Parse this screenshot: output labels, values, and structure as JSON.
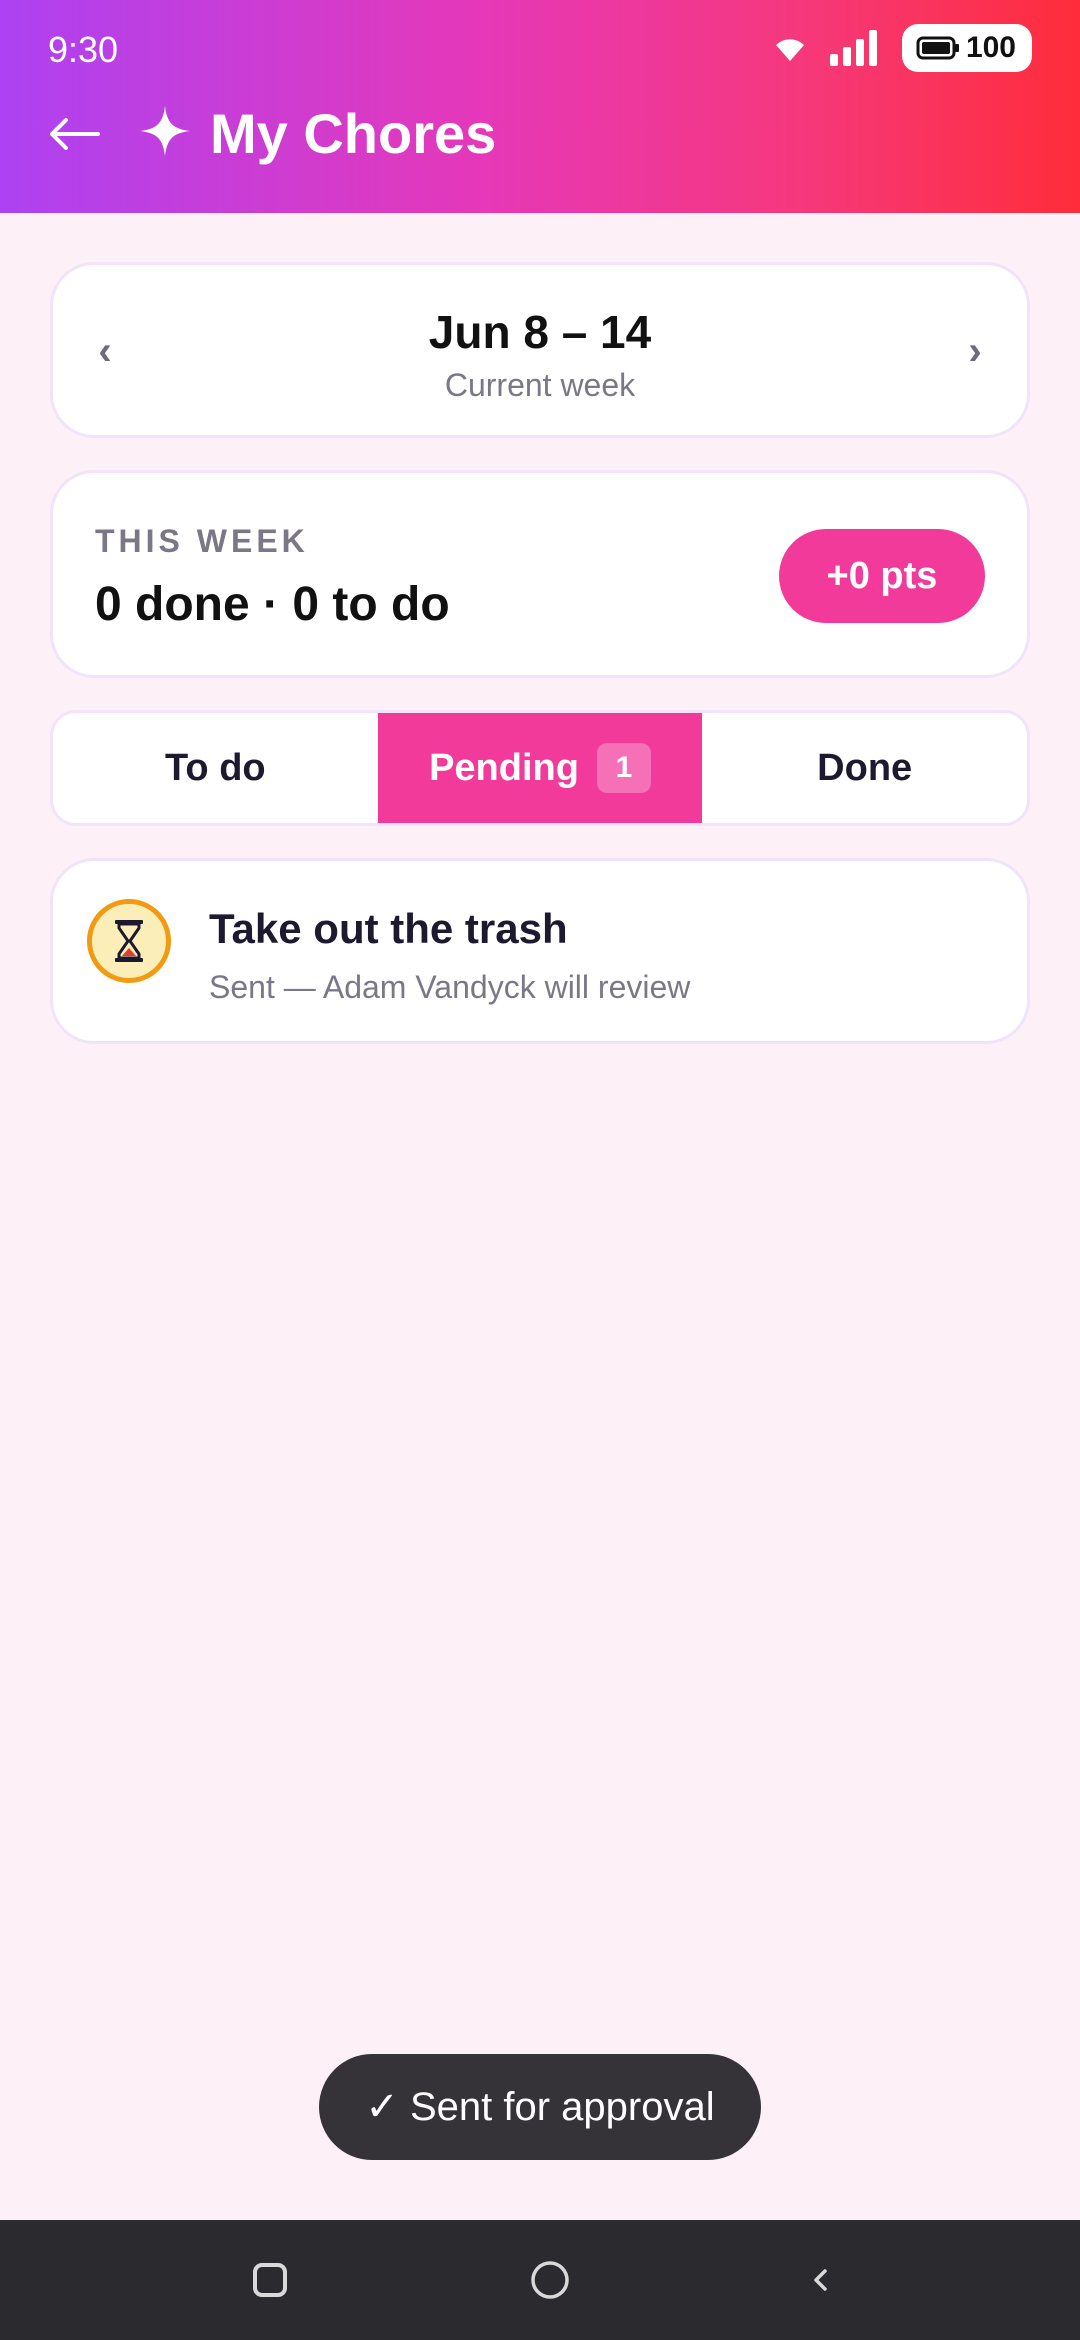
{
  "status_bar": {
    "time": "9:30",
    "battery_level": "100",
    "icons": [
      "wifi-icon",
      "signal-icon",
      "battery-icon"
    ]
  },
  "header": {
    "back_icon": "arrow-left-icon",
    "title_icon": "sparkle-icon",
    "title": "My Chores",
    "gradient_colors": [
      "#ad42f2",
      "#e638b8",
      "#ff2d3a"
    ]
  },
  "week_selector": {
    "prev_symbol": "‹",
    "next_symbol": "›",
    "range": "Jun 8 – 14",
    "caption": "Current week"
  },
  "summary": {
    "label": "THIS WEEK",
    "value": "0 done · 0 to do",
    "points": "+0 pts"
  },
  "tabs": [
    {
      "label": "To do",
      "active": false
    },
    {
      "label": "Pending",
      "active": true,
      "badge": "1"
    },
    {
      "label": "Done",
      "active": false
    }
  ],
  "chores": [
    {
      "icon": "hourglass-icon",
      "title": "Take out the trash",
      "status": "Sent — Adam Vandyck will review"
    }
  ],
  "toast": {
    "text": "✓ Sent for approval"
  },
  "nav_bar": {
    "icons": [
      "recent-apps-icon",
      "home-icon",
      "back-icon"
    ]
  },
  "colors": {
    "accent": "#f23a9a",
    "background": "#fdf0f7",
    "pending_icon_ring": "#f29a12",
    "pending_icon_fill": "#fbeeb8"
  }
}
